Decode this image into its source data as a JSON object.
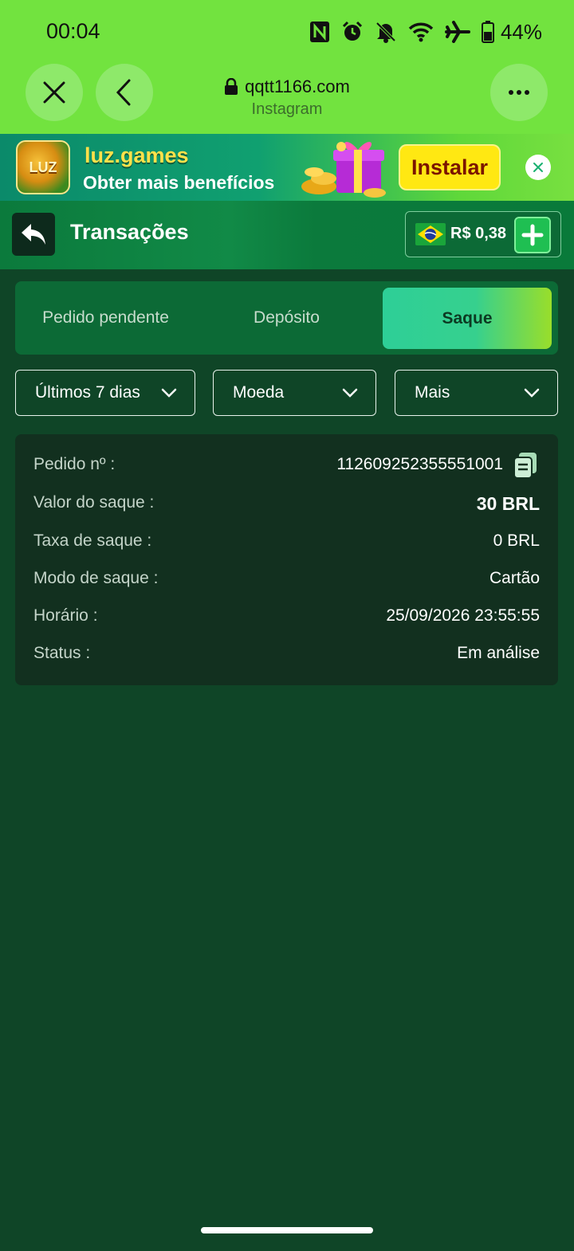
{
  "status_bar": {
    "time": "00:04",
    "battery": "44%",
    "icons": [
      "nfc-icon",
      "alarm-icon",
      "bell-off-icon",
      "wifi-icon",
      "airplane-icon",
      "battery-icon"
    ]
  },
  "browser": {
    "url": "qqtt1166.com",
    "source": "Instagram",
    "close_icon": "close-icon",
    "back_icon": "chevron-left-icon",
    "menu_icon": "more-icon"
  },
  "banner": {
    "app_name": "luz.games",
    "subtitle": "Obter mais benefícios",
    "logo_text": "LUZ",
    "install_label": "Instalar"
  },
  "header": {
    "title": "Transações",
    "balance": "R$ 0,38"
  },
  "tabs": [
    {
      "label": "Pedido pendente",
      "active": false
    },
    {
      "label": "Depósito",
      "active": false
    },
    {
      "label": "Saque",
      "active": true
    }
  ],
  "filters": {
    "period": "Últimos 7 dias",
    "currency": "Moeda",
    "more": "Mais"
  },
  "transaction": {
    "order_label": "Pedido nº :",
    "order_value": "112609252355551001",
    "amount_label": "Valor do saque :",
    "amount_value": "30 BRL",
    "fee_label": "Taxa de saque :",
    "fee_value": "0 BRL",
    "mode_label": "Modo de saque :",
    "mode_value": "Cartão",
    "time_label": "Horário :",
    "time_value": "25/09/2026 23:55:55",
    "status_label": "Status :",
    "status_value": "Em análise"
  },
  "colors": {
    "chrome_green": "#72e33f",
    "page_bg": "#0f4527",
    "tab_active_start": "#2ecf97",
    "tab_active_end": "#9ade2a",
    "install_yellow": "#ffe812"
  }
}
